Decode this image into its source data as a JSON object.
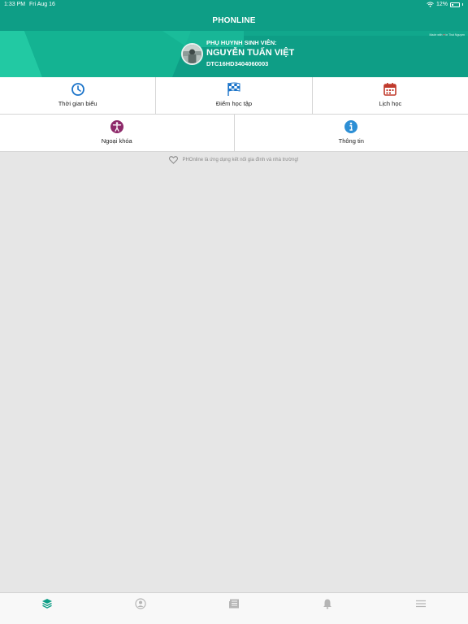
{
  "status_bar": {
    "time": "1:33 PM",
    "date": "Fri Aug 16",
    "battery": "12%",
    "icons": [
      "wifi-icon",
      "battery-icon"
    ]
  },
  "app": {
    "title": "PHONLINE"
  },
  "banner": {
    "made_with_prefix": "Made with",
    "made_with_suffix": "in Thai Nguyen",
    "role": "PHỤ HUYNH SINH VIÊN:",
    "name": "NGUYỄN TUẤN VIỆT",
    "student_code": "DTC16HD3404060003"
  },
  "menu": {
    "row1": [
      {
        "label": "Thời gian biểu",
        "icon": "clock-icon",
        "color": "#1a73c9"
      },
      {
        "label": "Điểm học tập",
        "icon": "checkered-flag-icon",
        "color": "#1a73c9"
      },
      {
        "label": "Lịch học",
        "icon": "calendar-icon",
        "color": "#c0392b"
      }
    ],
    "row2": [
      {
        "label": "Ngoại khóa",
        "icon": "accessibility-icon",
        "color": "#8e2a6a"
      },
      {
        "label": "Thông tin",
        "icon": "info-icon",
        "color": "#2d8fd5"
      }
    ]
  },
  "footer_note": "PHOnline là ứng dụng kết nối gia đình và nhà trường!",
  "tab_bar": {
    "active_color": "#0e9e86",
    "inactive_color": "#b5b5b5",
    "tabs": [
      "layers-icon",
      "profile-icon",
      "newspaper-icon",
      "bell-icon",
      "hamburger-menu-icon"
    ]
  }
}
